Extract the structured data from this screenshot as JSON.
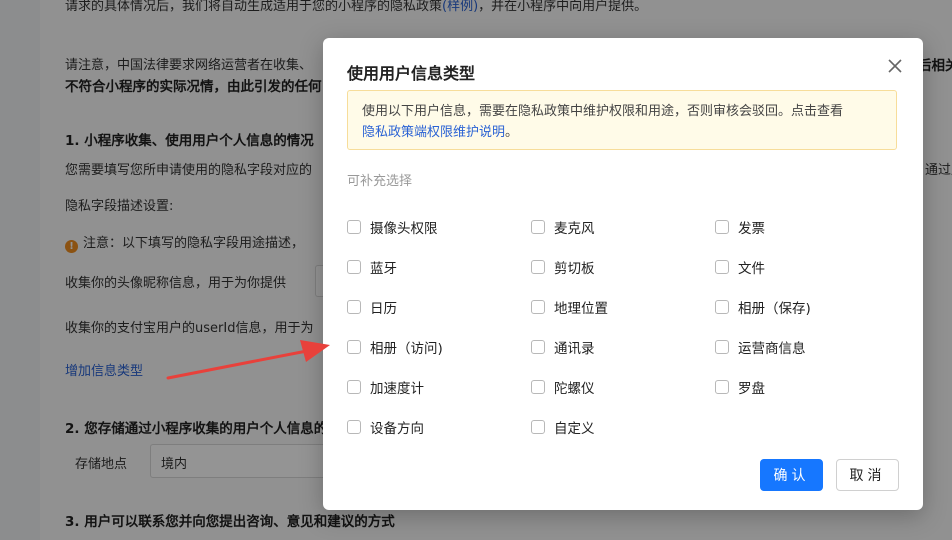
{
  "background": {
    "line1": "请求的具体情况后，我们将自动生成适用于您的小程序的隐私政策",
    "line1_link": "(样例)",
    "line1_tail": "，并在小程序中向用户提供。",
    "notice1": "请注意，中国法律要求网络运营者在收集、",
    "notice1_right": "后相关",
    "notice2": "不符合小程序的实际况情，由此引发的任何",
    "section1_title": "1. 小程序收集、使用用户个人信息的情况",
    "section1_desc": "您需要填写您所申请使用的隐私字段对应的",
    "section1_desc_right": "通过后",
    "privacy_desc_label": "隐私字段描述设置:",
    "warning_text": "注意：以下填写的隐私字段用途描述，",
    "row1_label": "收集你的头像昵称信息，用于为你提供",
    "row2_label": "收集你的支付宝用户的userId信息，用于为",
    "add_info_link": "增加信息类型",
    "section2_title": "2. 您存储通过小程序收集的用户个人信息的",
    "storage_label": "存储地点",
    "storage_value": "境内",
    "section3_title": "3. 用户可以联系您并向您提出咨询、意见和建议的方式"
  },
  "modal": {
    "title": "使用用户信息类型",
    "notice_text": "使用以下用户信息，需要在隐私政策中维护权限和用途，否则审核会驳回。点击查看",
    "notice_link": "隐私政策端权限维护说明",
    "notice_end": "。",
    "section_label": "可补充选择",
    "options": [
      "摄像头权限",
      "麦克风",
      "发票",
      "蓝牙",
      "剪切板",
      "文件",
      "日历",
      "地理位置",
      "相册（保存)",
      "相册（访问)",
      "通讯录",
      "运营商信息",
      "加速度计",
      "陀螺仪",
      "罗盘",
      "设备方向",
      "自定义"
    ],
    "confirm_label": "确认",
    "cancel_label": "取消"
  },
  "colors": {
    "primary": "#1677ff",
    "link": "#2a62d4",
    "annotation_arrow": "#e8413b"
  }
}
